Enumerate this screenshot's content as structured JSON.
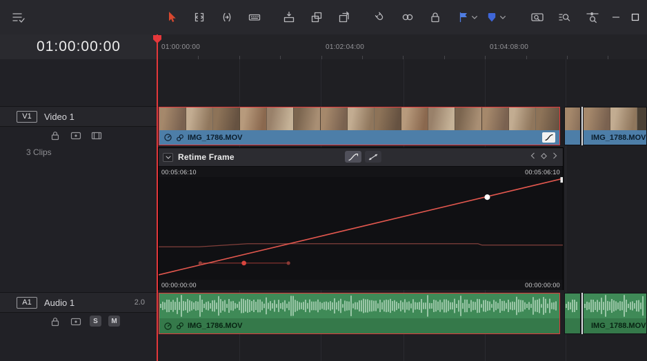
{
  "toolbar": {
    "icons": [
      "timeline-options",
      "pointer-tool",
      "trim-edit-mode",
      "dynamic-trim-mode",
      "razor-edit-mode",
      "insert-clip",
      "overwrite-clip",
      "replace-clip",
      "snapping",
      "linked-selection",
      "position-lock",
      "flag",
      "flag-dropdown",
      "marker",
      "marker-dropdown",
      "zoom-full-extent",
      "zoom-detail",
      "zoom-custom",
      "minimize",
      "timeline-view-box"
    ],
    "active_tool": "pointer-tool"
  },
  "timecode_display": "01:00:00:00",
  "ruler": {
    "labels": [
      "01:00:00:00",
      "01:02:04:00",
      "01:04:08:00"
    ]
  },
  "tracks": {
    "video": {
      "badge": "V1",
      "name": "Video 1",
      "clip_count": "3 Clips"
    },
    "audio": {
      "badge": "A1",
      "name": "Audio 1",
      "channels": "2.0",
      "solo_label": "S",
      "mute_label": "M"
    }
  },
  "clips": {
    "video_main": {
      "name": "IMG_1786.MOV"
    },
    "video_right": {
      "name": "IMG_1788.MOV"
    },
    "audio_main": {
      "name": "IMG_1786.MOV"
    },
    "audio_right": {
      "name": "IMG_1788.MOV"
    }
  },
  "retime_panel": {
    "title": "Retime Frame",
    "top_left_timecode": "00:05:06:10",
    "top_right_timecode": "00:05:06:10",
    "bottom_left_timecode": "00:00:00:00",
    "bottom_right_timecode": "00:00:00:00",
    "curve": {
      "main_line": [
        [
          0,
          0.953
        ],
        [
          1,
          0.014
        ]
      ],
      "white_point": [
        0.813,
        0.196
      ],
      "end_marker": [
        1,
        0.014
      ],
      "secondary_line": [
        [
          0,
          0.68
        ],
        [
          0.1,
          0.68
        ],
        [
          0.22,
          0.649
        ],
        [
          0.79,
          0.649
        ],
        [
          0.8,
          0.663
        ],
        [
          1,
          0.663
        ]
      ],
      "handle_points": [
        [
          0.103,
          0.838
        ],
        [
          0.211,
          0.838
        ],
        [
          0.321,
          0.838
        ]
      ]
    }
  },
  "colors": {
    "playhead": "#e5383b",
    "selection": "#e5383b",
    "video_clip_bar": "#4d7ea8",
    "audio_clip": "#3f8a57",
    "curve_line": "#e2574e",
    "flag_blue": "#4f7de2",
    "marker_blue": "#3f66d8"
  }
}
